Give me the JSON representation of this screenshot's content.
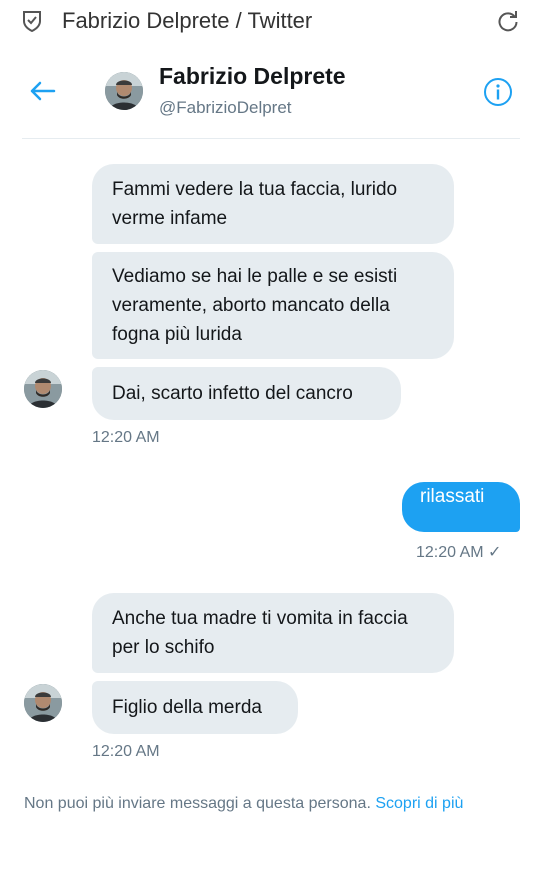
{
  "browser": {
    "title": "Fabrizio Delprete / Twitter",
    "icons": [
      "shield-icon",
      "refresh-icon"
    ]
  },
  "header": {
    "name": "Fabrizio Delprete",
    "handle": "@FabrizioDelpret",
    "icons": [
      "back-arrow-icon",
      "info-icon"
    ]
  },
  "colors": {
    "accent": "#1da1f2",
    "incoming_bubble": "#e6ecf0",
    "muted_text": "#657786"
  },
  "messages": [
    {
      "direction": "in",
      "text": "Fammi vedere la tua faccia, lurido verme infame"
    },
    {
      "direction": "in",
      "text": "Vediamo se hai le palle e se esisti veramente, aborto mancato della fogna più lurida"
    },
    {
      "direction": "in",
      "text": "Dai, scarto infetto del cancro",
      "timestamp": "12:20 AM"
    },
    {
      "direction": "out",
      "text": "rilassati",
      "timestamp": "12:20 AM ✓"
    },
    {
      "direction": "in",
      "text": "Anche tua madre ti vomita in faccia per lo schifo"
    },
    {
      "direction": "in",
      "text": "Figlio della merda",
      "timestamp": "12:20 AM"
    }
  ],
  "notice": {
    "text": "Non puoi più inviare messaggi a questa persona.",
    "link": "Scopri di più"
  }
}
